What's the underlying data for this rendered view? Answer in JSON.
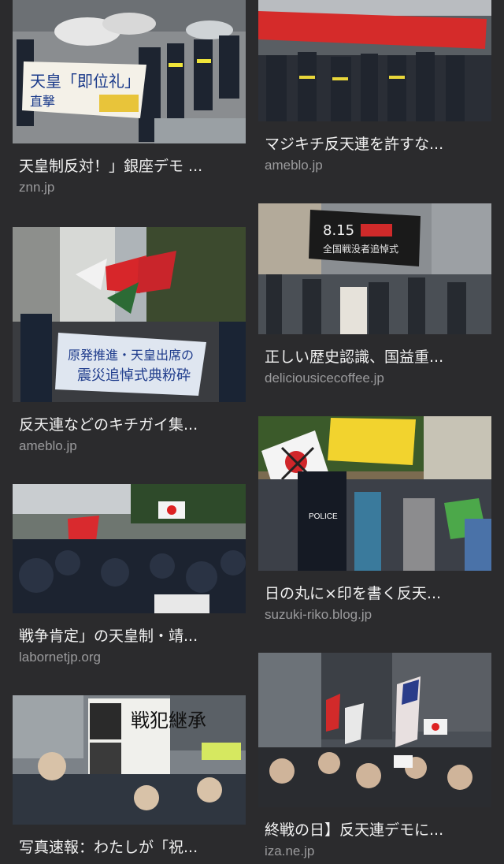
{
  "results": [
    {
      "title": "天皇制反対！」銀座デモ ...",
      "source": "znn.jp",
      "image_alt": "protest-march-umbrellas-banner"
    },
    {
      "title": "マジキチ反天連を許すな...",
      "source": "ameblo.jp",
      "image_alt": "protest-crowd-red-banner"
    },
    {
      "title": "反天連などのキチガイ集...",
      "source": "ameblo.jp",
      "image_alt": "protest-banner-red-flags"
    },
    {
      "title": "正しい歴史認識、国益重...",
      "source": "deliciousicecoffee.jp",
      "image_alt": "protest-black-banner-megaphone"
    },
    {
      "title": "戦争肯定」の天皇制・靖...",
      "source": "labornetjp.org",
      "image_alt": "riot-police-crowd"
    },
    {
      "title": "日の丸に×印を書く反天...",
      "source": "suzuki-riko.blog.jp",
      "image_alt": "crossed-out-flag-police"
    },
    {
      "title": "写真速報：わたしが「祝...",
      "source": "",
      "image_alt": "protest-placard-crowd"
    },
    {
      "title": "終戦の日】反天連デモに...",
      "source": "iza.ne.jp",
      "image_alt": "crowd-with-flags-street"
    }
  ],
  "image_text": {
    "banner1": "天皇「即位礼」",
    "banner1b": "直撃",
    "banner2": "原発推進・天皇出席の",
    "banner2b": "震災追悼式典粉砕",
    "banner3": "8.15",
    "banner3b": "全国戦没者追悼式",
    "police": "POLICE",
    "placard": "戦犯継承"
  }
}
